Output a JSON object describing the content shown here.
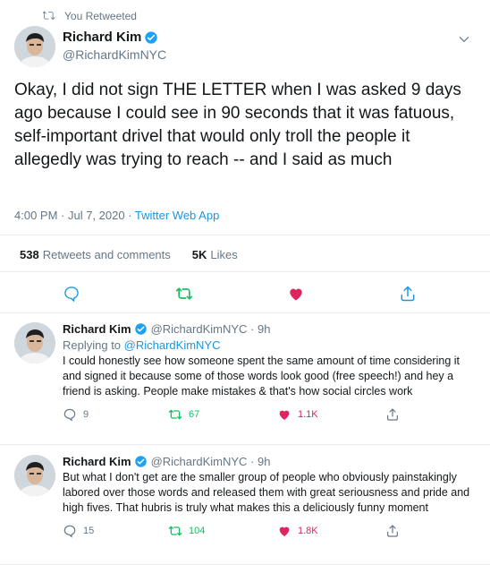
{
  "context": {
    "label": "You Retweeted"
  },
  "main_tweet": {
    "name": "Richard Kim",
    "handle": "@RichardKimNYC",
    "text": "Okay, I did not sign THE LETTER when I was asked 9 days ago because I could see in 90 seconds that it was fatuous, self-important drivel that would only troll the people it allegedly was trying to reach -- and I said as much",
    "time": "4:00 PM · Jul 7, 2020 · ",
    "source": "Twitter Web App",
    "stats": {
      "retweets_count": "538",
      "retweets_label": "Retweets and comments",
      "likes_count": "5K",
      "likes_label": "Likes"
    }
  },
  "replies": [
    {
      "name": "Richard Kim",
      "meta": "@RichardKimNYC · 9h",
      "replying_label": "Replying to ",
      "replying_to": "@RichardKimNYC",
      "text": "I could honestly see how someone spent the same amount of time considering it and signed it because some of those words look good (free speech!) and hey a friend is asking. People make mistakes & that's how social circles work",
      "reply_count": "9",
      "retweet_count": "67",
      "like_count": "1.1K"
    },
    {
      "name": "Richard Kim",
      "meta": "@RichardKimNYC · 9h",
      "text": "But what I don't get are the smaller group of people who obviously painstakingly labored over those words and released them with great seriousness and pride and high fives. That hubris is truly what makes this a deliciously funny moment",
      "reply_count": "15",
      "retweet_count": "104",
      "like_count": "1.8K"
    }
  ],
  "icons": {
    "retweet": "retweet-icon",
    "verified": "verified-badge-icon",
    "caret": "chevron-down-icon",
    "reply": "reply-icon",
    "like": "heart-icon",
    "share": "share-icon"
  },
  "colors": {
    "accent": "#1b95e0",
    "retweet_active": "#17bf63",
    "like_active": "#e0245e",
    "muted": "#657786"
  }
}
